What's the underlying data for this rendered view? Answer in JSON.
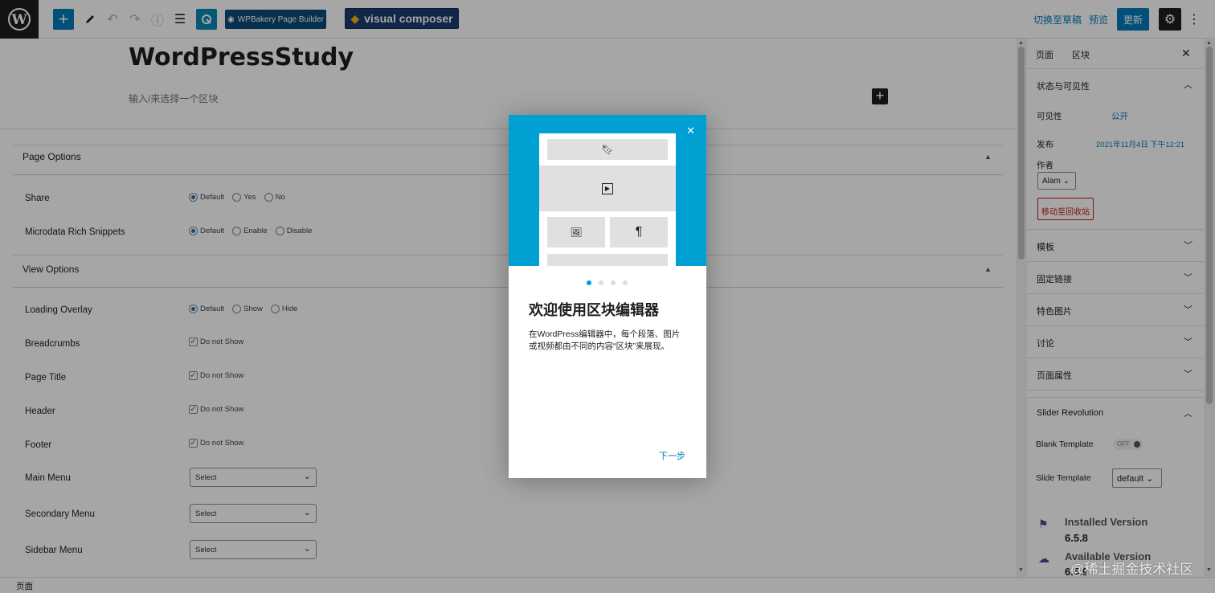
{
  "topbar": {
    "wpb_label": "WPBakery Page Builder",
    "vc_label": "visual composer",
    "draft_label": "切换至草稿",
    "preview_label": "预览",
    "update_label": "更新"
  },
  "editor": {
    "post_title": "WordPressStudy",
    "block_placeholder": "输入/来选择一个区块"
  },
  "page_options": {
    "title": "Page Options",
    "share_label": "Share",
    "share_options": [
      "Default",
      "Yes",
      "No"
    ],
    "microdata_label": "Microdata Rich Snippets",
    "microdata_options": [
      "Default",
      "Enable",
      "Disable"
    ]
  },
  "view_options": {
    "title": "View Options",
    "loading_label": "Loading Overlay",
    "loading_options": [
      "Default",
      "Show",
      "Hide"
    ],
    "breadcrumbs_label": "Breadcrumbs",
    "page_title_label": "Page Title",
    "header_label": "Header",
    "footer_label": "Footer",
    "do_not_show": "Do not Show",
    "main_menu_label": "Main Menu",
    "secondary_menu_label": "Secondary Menu",
    "sidebar_menu_label": "Sidebar Menu",
    "select_value": "Select"
  },
  "sidebar": {
    "tab_page": "页面",
    "tab_block": "区块",
    "status_title": "状态与可见性",
    "visibility_label": "可见性",
    "visibility_value": "公开",
    "publish_label": "发布",
    "publish_value": "2021年11月4日 下午12:21",
    "author_label": "作者",
    "author_value": "Alam",
    "trash_label": "移动至回收站",
    "sections": [
      "模板",
      "固定链接",
      "特色图片",
      "讨论",
      "页面属性"
    ],
    "slider_title": "Slider Revolution",
    "blank_template_label": "Blank Template",
    "toggle_value": "OFF",
    "slide_template_label": "Slide Template",
    "slide_template_value": "default",
    "installed_label": "Installed Version",
    "installed_value": "6.5.8",
    "available_label": "Available Version",
    "available_value": "6.5.9"
  },
  "footer": {
    "breadcrumb": "页面"
  },
  "modal": {
    "title": "欢迎使用区块编辑器",
    "body": "在WordPress编辑器中，每个段落、图片或视频都由不同的内容“区块”来展现。",
    "next_label": "下一步",
    "page_count": 4,
    "current_page": 1
  },
  "watermark": "@稀土掘金技术社区",
  "colors": {
    "accent": "#007cba",
    "modal_header": "#00a0d2",
    "danger": "#cc1818"
  }
}
